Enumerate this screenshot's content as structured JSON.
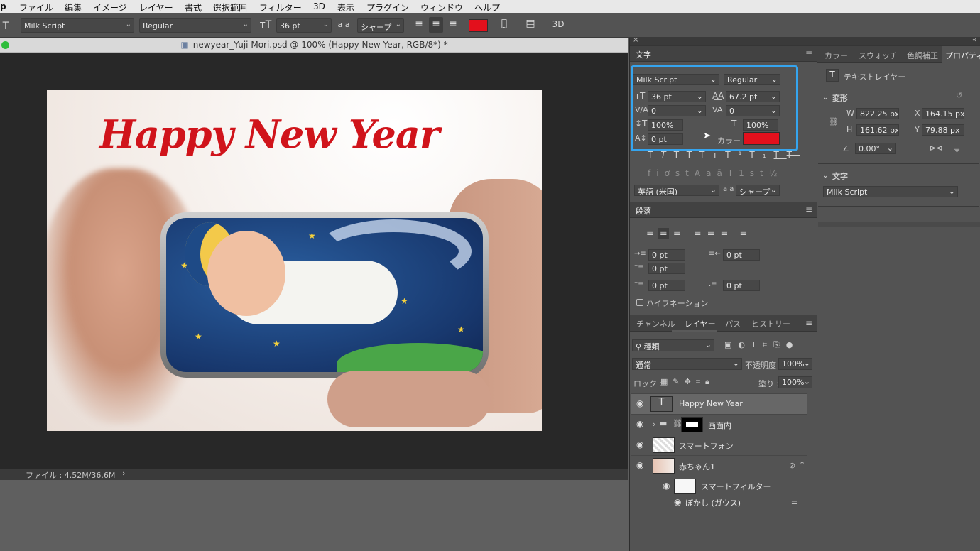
{
  "menubar": {
    "app": "p",
    "items": [
      "ファイル",
      "編集",
      "イメージ",
      "レイヤー",
      "書式",
      "選択範囲",
      "フィルター",
      "3D",
      "表示",
      "プラグイン",
      "ウィンドウ",
      "ヘルプ"
    ]
  },
  "options": {
    "font_family": "Milk Script",
    "font_style": "Regular",
    "font_size": "36 pt",
    "aa_label": "a a",
    "antialias": "シャープ",
    "color": "#e3101c",
    "three_d": "3D"
  },
  "document": {
    "title": "newyear_Yuji Mori.psd @ 100% (Happy New Year, RGB/8*) *",
    "headline": "Happy New Year",
    "status": "ファイル : 4.52M/36.6M",
    "status_arrow": "›"
  },
  "character": {
    "title": "文字",
    "font_family": "Milk Script",
    "font_style": "Regular",
    "size": "36 pt",
    "leading": "67.2 pt",
    "kerning": "0",
    "tracking": "0",
    "vscale": "100%",
    "hscale": "100%",
    "baseline": "0 pt",
    "color_label": "カラー :",
    "color": "#e3101c",
    "language": "英語 (米国)",
    "aa_label": "a a",
    "antialias": "シャープ"
  },
  "paragraph": {
    "title": "段落",
    "indent_left": "0 pt",
    "indent_right": "0 pt",
    "indent_first": "0 pt",
    "space_before": "0 pt",
    "space_after": "0 pt",
    "hyphenation": "ハイフネーション"
  },
  "layers_panel": {
    "tabs": [
      "チャンネル",
      "レイヤー",
      "パス",
      "ヒストリー"
    ],
    "filter_kind": "種類",
    "blend_mode": "通常",
    "opacity_label": "不透明度 :",
    "opacity": "100%",
    "lock_label": "ロック :",
    "fill_label": "塗り :",
    "fill": "100%",
    "layers": [
      {
        "name": "Happy New Year"
      },
      {
        "name": "画面内"
      },
      {
        "name": "スマートフォン"
      },
      {
        "name": "赤ちゃん1"
      },
      {
        "name": "スマートフィルター"
      },
      {
        "name": "ぼかし (ガウス)"
      }
    ]
  },
  "properties": {
    "tabs": [
      "カラー",
      "スウォッチ",
      "色調補正",
      "プロパティ"
    ],
    "layer_kind": "テキストレイヤー",
    "transform_title": "変形",
    "w_label": "W",
    "w": "822.25 px",
    "h_label": "H",
    "h": "161.62 px",
    "x_label": "X",
    "x": "164.15 px",
    "y_label": "Y",
    "y": "79.88 px",
    "angle": "0.00°",
    "char_title": "文字",
    "font_family": "Milk Script"
  }
}
